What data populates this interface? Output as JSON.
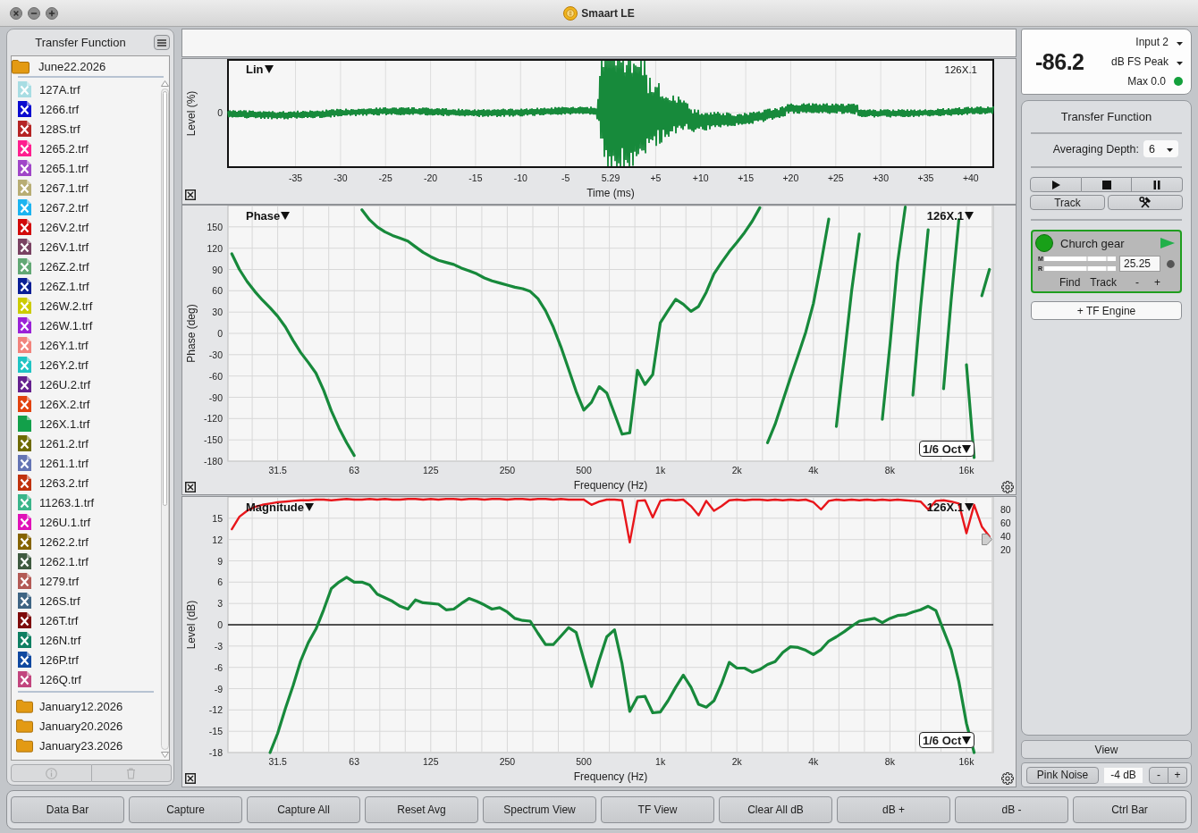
{
  "window": {
    "title": "Smaart LE"
  },
  "sidebar": {
    "title": "Transfer Function",
    "open_folder": {
      "name": "June22.2026",
      "selected": false,
      "files": [
        {
          "name": "127A.trf",
          "color": "#a8dde3",
          "crossed": true,
          "selected": false
        },
        {
          "name": "1266.trf",
          "color": "#0a0ad0",
          "crossed": true,
          "selected": false
        },
        {
          "name": "128S.trf",
          "color": "#b52424",
          "crossed": true,
          "selected": false
        },
        {
          "name": "1265.2.trf",
          "color": "#ff1f8f",
          "crossed": true,
          "selected": false
        },
        {
          "name": "1265.1.trf",
          "color": "#a046c8",
          "crossed": true,
          "selected": false
        },
        {
          "name": "1267.1.trf",
          "color": "#b8ad74",
          "crossed": true,
          "selected": false
        },
        {
          "name": "1267.2.trf",
          "color": "#1cb4f0",
          "crossed": true,
          "selected": false
        },
        {
          "name": "126V.2.trf",
          "color": "#d20a0a",
          "crossed": true,
          "selected": false
        },
        {
          "name": "126V.1.trf",
          "color": "#7a4262",
          "crossed": true,
          "selected": false
        },
        {
          "name": "126Z.2.trf",
          "color": "#62a874",
          "crossed": true,
          "selected": false
        },
        {
          "name": "126Z.1.trf",
          "color": "#0a1e96",
          "crossed": true,
          "selected": false
        },
        {
          "name": "126W.2.trf",
          "color": "#cccc00",
          "crossed": true,
          "selected": false
        },
        {
          "name": "126W.1.trf",
          "color": "#9a22d8",
          "crossed": true,
          "selected": false
        },
        {
          "name": "126Y.1.trf",
          "color": "#f2837c",
          "crossed": true,
          "selected": false
        },
        {
          "name": "126Y.2.trf",
          "color": "#1fc4c4",
          "crossed": true,
          "selected": false
        },
        {
          "name": "126U.2.trf",
          "color": "#65208e",
          "crossed": true,
          "selected": false
        },
        {
          "name": "126X.2.trf",
          "color": "#e2420e",
          "crossed": true,
          "selected": false
        },
        {
          "name": "126X.1.trf",
          "color": "#12a04a",
          "crossed": false,
          "selected": false
        },
        {
          "name": "1261.2.trf",
          "color": "#6e6a00",
          "crossed": true,
          "selected": false
        },
        {
          "name": "1261.1.trf",
          "color": "#6474b4",
          "crossed": true,
          "selected": false
        },
        {
          "name": "1263.2.trf",
          "color": "#c0320e",
          "crossed": true,
          "selected": false
        },
        {
          "name": "11263.1.trf",
          "color": "#3ab58a",
          "crossed": true,
          "selected": false
        },
        {
          "name": "126U.1.trf",
          "color": "#e012b8",
          "crossed": true,
          "selected": false
        },
        {
          "name": "1262.2.trf",
          "color": "#856400",
          "crossed": true,
          "selected": false
        },
        {
          "name": "1262.1.trf",
          "color": "#3f5a40",
          "crossed": true,
          "selected": false
        },
        {
          "name": "1279.trf",
          "color": "#b35a55",
          "crossed": true,
          "selected": false
        },
        {
          "name": "126S.trf",
          "color": "#3f6584",
          "crossed": true,
          "selected": false
        },
        {
          "name": "126T.trf",
          "color": "#7e0a0a",
          "crossed": true,
          "selected": false
        },
        {
          "name": "126N.trf",
          "color": "#0e7f62",
          "crossed": true,
          "selected": false
        },
        {
          "name": "126P.trf",
          "color": "#0f48a0",
          "crossed": true,
          "selected": false
        },
        {
          "name": "126Q.trf",
          "color": "#c2457e",
          "crossed": true,
          "selected": false
        }
      ]
    },
    "folders": [
      {
        "name": "January12.2026",
        "selected": false
      },
      {
        "name": "January20.2026",
        "selected": false
      },
      {
        "name": "January23.2026",
        "selected": false
      }
    ],
    "footer_buttons": [
      {
        "disabled": true
      },
      {
        "disabled": true
      }
    ]
  },
  "impulse": {
    "mode": "Lin",
    "trace": "126X.1",
    "ylabel": "Level (%)",
    "yticks": [
      "0"
    ],
    "xlabel": "Time (ms)",
    "xticks": [
      "-35",
      "-30",
      "-25",
      "-20",
      "-15",
      "-10",
      "-5",
      "5.29",
      "+5",
      "+10",
      "+15",
      "+20",
      "+25",
      "+30",
      "+35",
      "+40"
    ]
  },
  "phase": {
    "chart_data": {
      "type": "line",
      "title": "Phase",
      "xlabel": "Frequency (Hz)",
      "ylabel": "Phase (deg)",
      "categories": [
        null,
        null,
        null,
        null,
        null,
        null,
        "31.5",
        null,
        null,
        null,
        null,
        null,
        null,
        null,
        null,
        null,
        "63",
        null,
        null,
        null,
        null,
        null,
        null,
        null,
        null,
        null,
        "125",
        null,
        null,
        null,
        null,
        null,
        null,
        null,
        null,
        null,
        "250",
        null,
        null,
        null,
        null,
        null,
        null,
        null,
        null,
        null,
        "500",
        null,
        null,
        null,
        null,
        null,
        null,
        null,
        null,
        null,
        "1k",
        null,
        null,
        null,
        null,
        null,
        null,
        null,
        null,
        null,
        "2k",
        null,
        null,
        null,
        null,
        null,
        null,
        null,
        null,
        null,
        "4k",
        null,
        null,
        null,
        null,
        null,
        null,
        null,
        null,
        null,
        "8k",
        null,
        null,
        null,
        null,
        null,
        null,
        null,
        null,
        null,
        "16k",
        null,
        null,
        null
      ],
      "series": [
        {
          "name": "126X.1",
          "color": "#17893b",
          "values": [
            112,
            90,
            73,
            59,
            47,
            36,
            24,
            9,
            -10,
            -27,
            -41,
            -56,
            -80,
            -109,
            -133,
            -154,
            -172,
            174,
            160,
            150,
            143,
            138,
            134,
            130,
            122,
            114,
            108,
            103,
            100,
            97,
            92,
            88,
            84,
            78,
            74,
            71,
            68,
            65,
            63,
            59,
            49,
            32,
            9,
            -19,
            -50,
            -82,
            -108,
            -97,
            -75,
            -84,
            -113,
            -142,
            -140,
            -52,
            -72,
            -58,
            15,
            32,
            48,
            41,
            31,
            38,
            58,
            84,
            100,
            115,
            128,
            142,
            158,
            177,
            -154,
            -128,
            -95,
            -62,
            -31,
            2,
            42,
            99,
            161,
            -131,
            -35,
            60,
            140,
            null,
            null,
            -121,
            -17,
            100,
            178,
            -87,
            37,
            146,
            null,
            -78,
            47,
            160,
            -44,
            -175,
            53,
            90
          ]
        }
      ],
      "ylim": [
        -180,
        180
      ],
      "yticks": [
        150,
        120,
        90,
        60,
        30,
        0,
        -30,
        -60,
        -90,
        -120,
        -150,
        -180
      ],
      "grid": true
    },
    "smoothing": "1/6 Oct"
  },
  "magnitude": {
    "chart_data": {
      "type": "line",
      "title": "Magnitude",
      "xlabel": "Frequency (Hz)",
      "ylabel": "Level (dB)",
      "categories": [
        null,
        null,
        null,
        null,
        null,
        null,
        "31.5",
        null,
        null,
        null,
        null,
        null,
        null,
        null,
        null,
        null,
        "63",
        null,
        null,
        null,
        null,
        null,
        null,
        null,
        null,
        null,
        "125",
        null,
        null,
        null,
        null,
        null,
        null,
        null,
        null,
        null,
        "250",
        null,
        null,
        null,
        null,
        null,
        null,
        null,
        null,
        null,
        "500",
        null,
        null,
        null,
        null,
        null,
        null,
        null,
        null,
        null,
        "1k",
        null,
        null,
        null,
        null,
        null,
        null,
        null,
        null,
        null,
        "2k",
        null,
        null,
        null,
        null,
        null,
        null,
        null,
        null,
        null,
        "4k",
        null,
        null,
        null,
        null,
        null,
        null,
        null,
        null,
        null,
        "8k",
        null,
        null,
        null,
        null,
        null,
        null,
        null,
        null,
        null,
        "16k",
        null,
        null,
        null
      ],
      "series": [
        {
          "name": "126X.1",
          "color": "#17893b",
          "values": [
            null,
            null,
            null,
            null,
            null,
            -18,
            -15.3,
            -11.8,
            -8.6,
            -5.1,
            -2.5,
            -0.6,
            2.1,
            5.1,
            6,
            6.7,
            6,
            6,
            5.6,
            4.3,
            3.8,
            3.3,
            2.6,
            2.2,
            3.5,
            3.1,
            3,
            2.9,
            2.1,
            2.2,
            3,
            3.7,
            3.3,
            2.8,
            2.2,
            2.4,
            1.8,
            0.9,
            0.6,
            0.5,
            -1.2,
            -2.8,
            -2.8,
            -1.6,
            -0.4,
            -1.1,
            -4.9,
            -8.7,
            -5,
            -1.7,
            -0.7,
            -5.5,
            -12.2,
            -10.2,
            -10.1,
            -12.4,
            -12.3,
            -10.7,
            -8.8,
            -7.1,
            -8.8,
            -11.2,
            -11.6,
            -10.7,
            -8.3,
            -5.3,
            -6.1,
            -6.1,
            -6.7,
            -6.3,
            -5.6,
            -5.2,
            -3.9,
            -3.1,
            -3.2,
            -3.6,
            -4.2,
            -3.5,
            -2.3,
            -1.7,
            -1,
            -0.2,
            0.5,
            0.7,
            0.9,
            0.3,
            0.9,
            1.3,
            1.4,
            1.8,
            2.1,
            2.6,
            2,
            -0.8,
            -3.5,
            -8,
            -13.9,
            -18,
            null,
            null
          ]
        }
      ],
      "ylim": [
        -18,
        18
      ],
      "yticks": [
        15,
        12,
        9,
        6,
        3,
        0,
        -3,
        -6,
        -9,
        -12,
        -15,
        -18
      ],
      "grid": true
    },
    "zero_line": true,
    "smoothing": "1/6 Oct",
    "coherence": {
      "chart_data": {
        "type": "line",
        "categories": [
          null,
          null,
          null,
          null,
          null,
          null,
          null,
          null,
          null,
          null,
          null,
          null,
          null,
          null,
          null,
          null,
          null,
          null,
          null,
          null,
          null,
          null,
          null,
          null,
          null,
          null,
          null,
          null,
          null,
          null,
          null,
          null,
          null,
          null,
          null,
          null,
          null,
          null,
          null,
          null,
          null,
          null,
          null,
          null,
          null,
          null,
          null,
          null,
          null,
          null,
          null,
          null,
          null,
          null,
          null,
          null,
          null,
          null,
          null,
          null,
          null,
          null,
          null,
          null,
          null,
          null,
          null,
          null,
          null,
          null,
          null,
          null,
          null,
          null,
          null,
          null,
          null,
          null,
          null,
          null,
          null,
          null,
          null,
          null,
          null,
          null,
          null,
          null,
          null,
          null,
          null,
          null,
          null,
          null,
          null,
          null,
          null,
          null,
          null,
          null
        ],
        "series": [
          {
            "color": "#e8161b",
            "values": [
              51,
              70,
              79,
              85,
              88,
              90,
              92,
              93,
              94,
              95,
              95,
              96,
              96,
              95,
              96,
              97,
              96,
              96,
              97,
              96,
              97,
              96,
              96,
              97,
              97,
              96,
              97,
              96,
              97,
              97,
              96,
              97,
              97,
              96,
              97,
              97,
              96,
              97,
              97,
              96,
              97,
              97,
              96,
              97,
              96,
              96,
              96,
              88,
              93,
              96,
              96,
              95,
              31,
              94,
              95,
              69,
              94,
              96,
              95,
              96,
              86,
              72,
              94,
              79,
              86,
              95,
              96,
              95,
              96,
              96,
              95,
              96,
              95,
              96,
              95,
              96,
              92,
              81,
              94,
              96,
              95,
              96,
              95,
              96,
              95,
              96,
              95,
              96,
              95,
              94,
              93,
              81,
              94,
              95,
              93,
              90,
              45,
              88,
              55,
              40
            ]
          }
        ],
        "ylim": [
          20,
          100
        ],
        "yticks": [
          20,
          40,
          60,
          80
        ]
      }
    }
  },
  "meter": {
    "reading": "-86.2",
    "input": "Input 2",
    "scale": "dB FS Peak",
    "max": "Max 0.0"
  },
  "tf_panel": {
    "title": "Transfer Function",
    "averaging_label": "Averaging Depth:",
    "averaging_value": "6",
    "track_button": "Track"
  },
  "engine": {
    "active": true,
    "name": "Church gear",
    "meter_labels": [
      "M",
      "R"
    ],
    "delay": "25.25",
    "actions": [
      "Find",
      "Track",
      "-",
      "+"
    ]
  },
  "add_engine_button": "+ TF Engine",
  "view_button": "View",
  "generator": {
    "button": "Pink Noise",
    "gain": "-4 dB",
    "steps": [
      "-",
      "+"
    ]
  },
  "toolbar": [
    "Data Bar",
    "Capture",
    "Capture All",
    "Reset Avg",
    "Spectrum View",
    "TF View",
    "Clear All dB",
    "dB +",
    "dB -",
    "Ctrl Bar"
  ]
}
